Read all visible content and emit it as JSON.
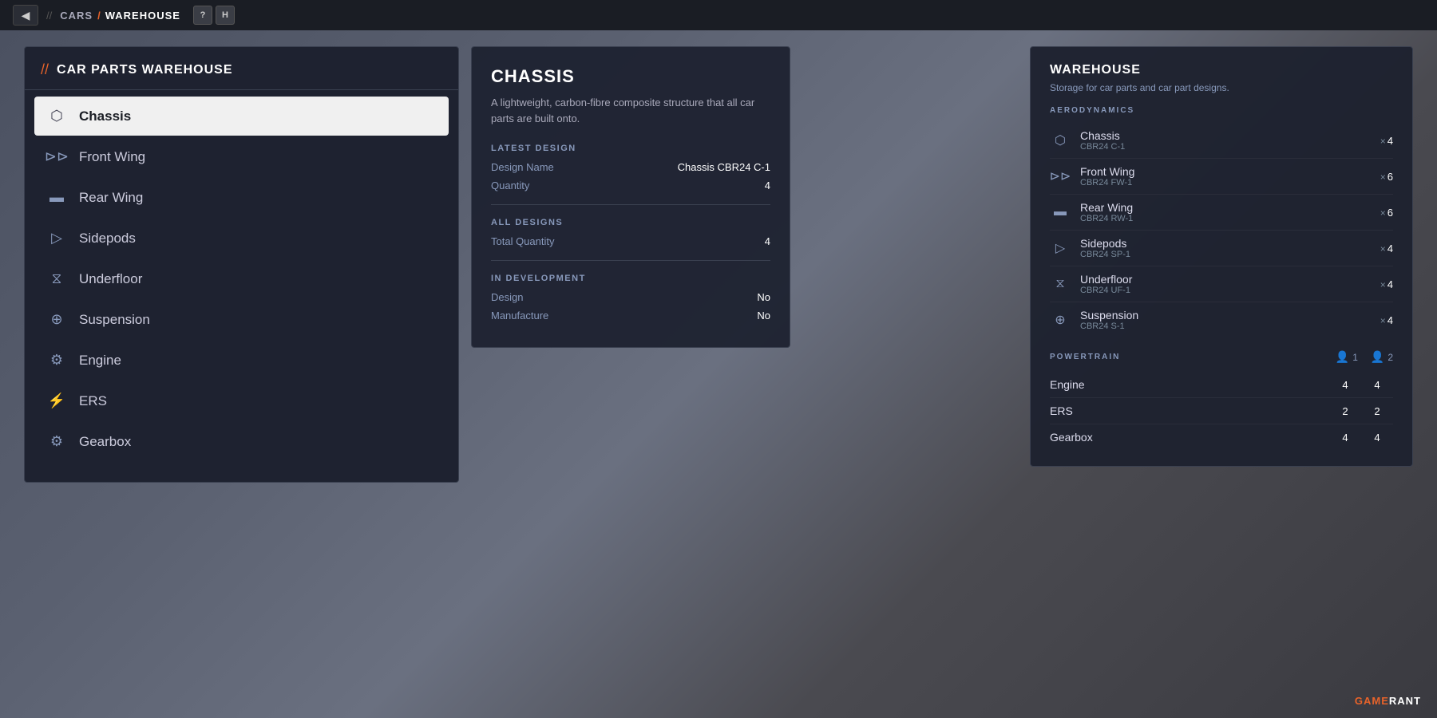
{
  "topbar": {
    "back_label": "◀",
    "separator": "//",
    "cars_label": "CARS",
    "slash": "/",
    "warehouse_label": "WAREHOUSE",
    "help_btn": "?",
    "home_btn": "H"
  },
  "left_panel": {
    "header_icon": "//",
    "title": "CAR PARTS WAREHOUSE",
    "parts": [
      {
        "id": "chassis",
        "label": "Chassis",
        "icon": "⬡",
        "active": true
      },
      {
        "id": "front-wing",
        "label": "Front Wing",
        "icon": "⟩⟩",
        "active": false
      },
      {
        "id": "rear-wing",
        "label": "Rear Wing",
        "icon": "▬",
        "active": false
      },
      {
        "id": "sidepods",
        "label": "Sidepods",
        "icon": "▷",
        "active": false
      },
      {
        "id": "underfloor",
        "label": "Underfloor",
        "icon": "⧖",
        "active": false
      },
      {
        "id": "suspension",
        "label": "Suspension",
        "icon": "⊕",
        "active": false
      },
      {
        "id": "engine",
        "label": "Engine",
        "icon": "⚙",
        "active": false
      },
      {
        "id": "ers",
        "label": "ERS",
        "icon": "⚡",
        "active": false
      },
      {
        "id": "gearbox",
        "label": "Gearbox",
        "icon": "⚙",
        "active": false
      }
    ]
  },
  "middle_panel": {
    "title": "CHASSIS",
    "description": "A lightweight, carbon-fibre composite structure that all car parts are built onto.",
    "latest_design_label": "LATEST DESIGN",
    "design_name_key": "Design Name",
    "design_name_val": "Chassis CBR24 C-1",
    "quantity_key": "Quantity",
    "quantity_val": "4",
    "all_designs_label": "ALL DESIGNS",
    "total_quantity_key": "Total Quantity",
    "total_quantity_val": "4",
    "in_development_label": "IN DEVELOPMENT",
    "design_key": "Design",
    "design_val": "No",
    "manufacture_key": "Manufacture",
    "manufacture_val": "No"
  },
  "right_panel": {
    "title": "WAREHOUSE",
    "description": "Storage for car parts and car part designs.",
    "aerodynamics_label": "AERODYNAMICS",
    "aero_items": [
      {
        "id": "chassis",
        "name": "Chassis",
        "sub": "CBR24 C-1",
        "qty": "4",
        "icon": "⬡"
      },
      {
        "id": "front-wing",
        "name": "Front Wing",
        "sub": "CBR24 FW-1",
        "qty": "6",
        "icon": "⟩⟩"
      },
      {
        "id": "rear-wing",
        "name": "Rear Wing",
        "sub": "CBR24 RW-1",
        "qty": "6",
        "icon": "▬"
      },
      {
        "id": "sidepods",
        "name": "Sidepods",
        "sub": "CBR24 SP-1",
        "qty": "4",
        "icon": "▷"
      },
      {
        "id": "underfloor",
        "name": "Underfloor",
        "sub": "CBR24 UF-1",
        "qty": "4",
        "icon": "⧖"
      },
      {
        "id": "suspension",
        "name": "Suspension",
        "sub": "CBR24 S-1",
        "qty": "4",
        "icon": "⊕"
      }
    ],
    "powertrain_label": "POWERTRAIN",
    "driver1_icon": "👤",
    "driver1_num": "1",
    "driver2_icon": "👤",
    "driver2_num": "2",
    "pt_items": [
      {
        "id": "engine",
        "name": "Engine",
        "val1": "4",
        "val2": "4"
      },
      {
        "id": "ers",
        "name": "ERS",
        "val1": "2",
        "val2": "2"
      },
      {
        "id": "gearbox",
        "name": "Gearbox",
        "val1": "4",
        "val2": "4"
      }
    ]
  },
  "watermark": {
    "prefix": "GAME",
    "suffix": "RANT"
  }
}
